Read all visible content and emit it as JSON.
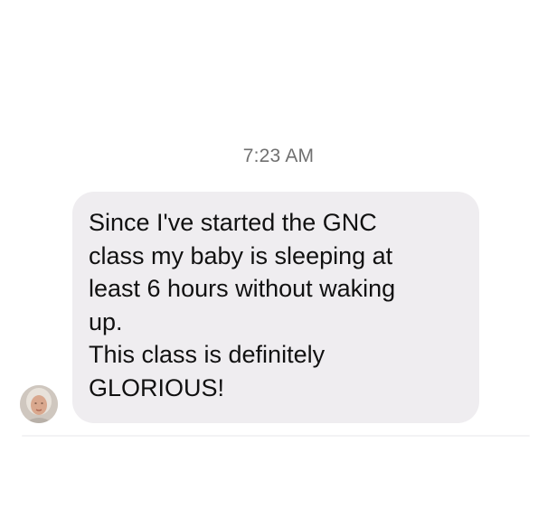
{
  "conversation": {
    "timestamp": "7:23 AM",
    "message": {
      "lines": [
        "Since I've started the GNC",
        "class my baby is sleeping at",
        "least 6 hours without waking",
        "up.",
        "This class is definitely",
        "GLORIOUS!"
      ]
    }
  },
  "colors": {
    "bubble": "#efedf0",
    "timestamp_text": "#707070",
    "message_text": "#111111",
    "background": "#ffffff"
  }
}
